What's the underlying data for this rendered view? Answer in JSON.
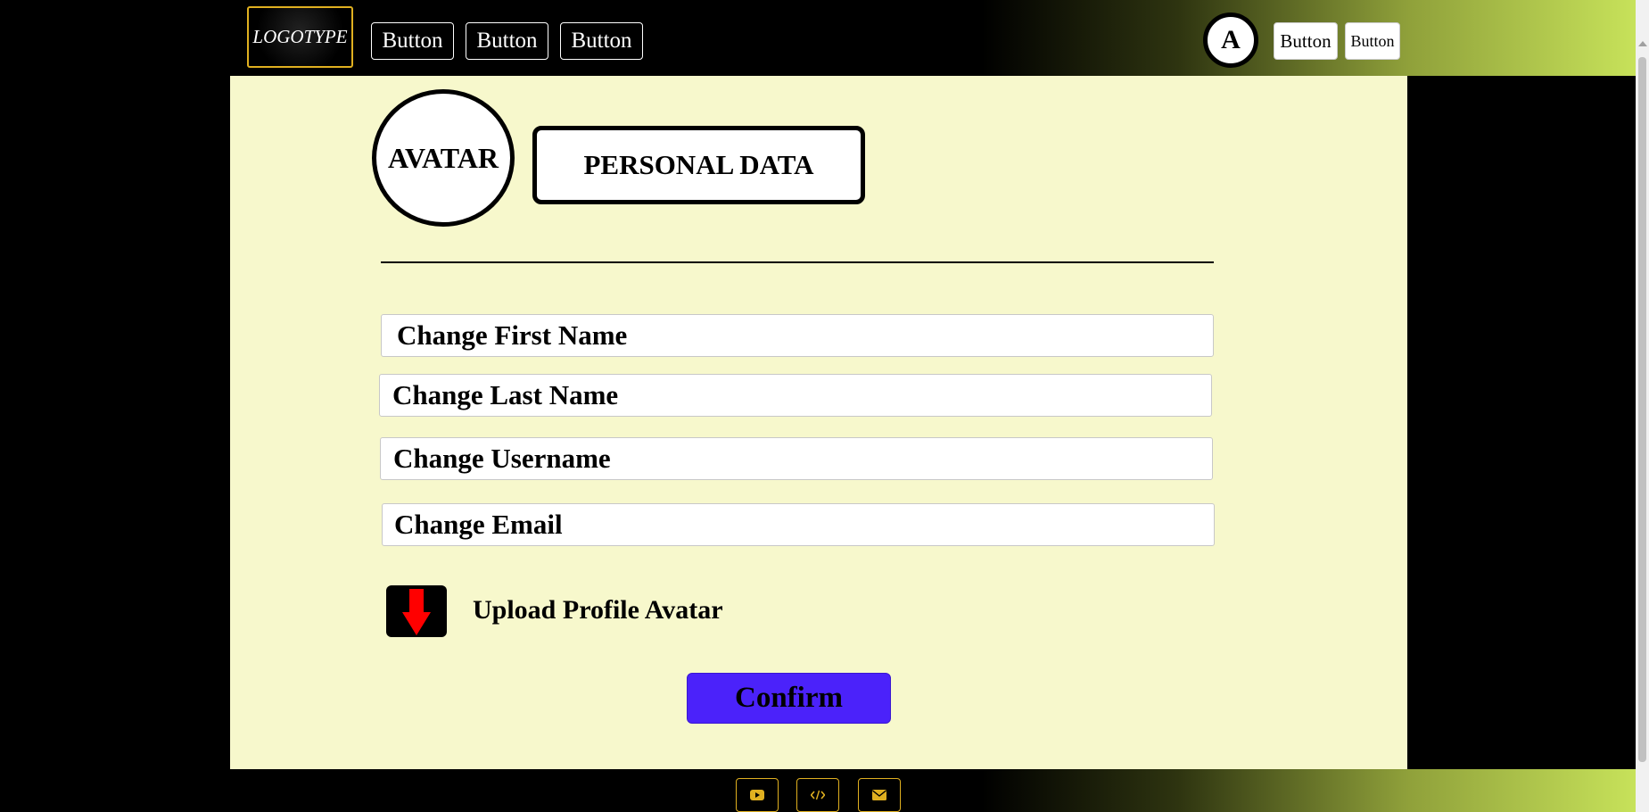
{
  "header": {
    "logo": "LOGOTYPE",
    "nav_buttons": [
      "Button",
      "Button",
      "Button"
    ],
    "user_avatar_letter": "A",
    "right_buttons": [
      "Button",
      "Button"
    ]
  },
  "profile": {
    "avatar_label": "AVATAR",
    "section_title": "PERSONAL DATA"
  },
  "form": {
    "fields": [
      {
        "placeholder": "Change First Name"
      },
      {
        "placeholder": "Change Last Name"
      },
      {
        "placeholder": "Change Username"
      },
      {
        "placeholder": "Change Email"
      }
    ],
    "upload_label": "Upload Profile Avatar",
    "confirm_label": "Confirm"
  },
  "footer": {
    "icons": [
      "youtube-icon",
      "code-icon",
      "mail-icon"
    ]
  },
  "colors": {
    "page_bg": "#000000",
    "content_bg": "#f7f8cc",
    "confirm_bg": "#4b22fa",
    "accent_border": "#e0b020",
    "gradient_end": "#c7e25a",
    "upload_arrow": "#ff0000"
  }
}
